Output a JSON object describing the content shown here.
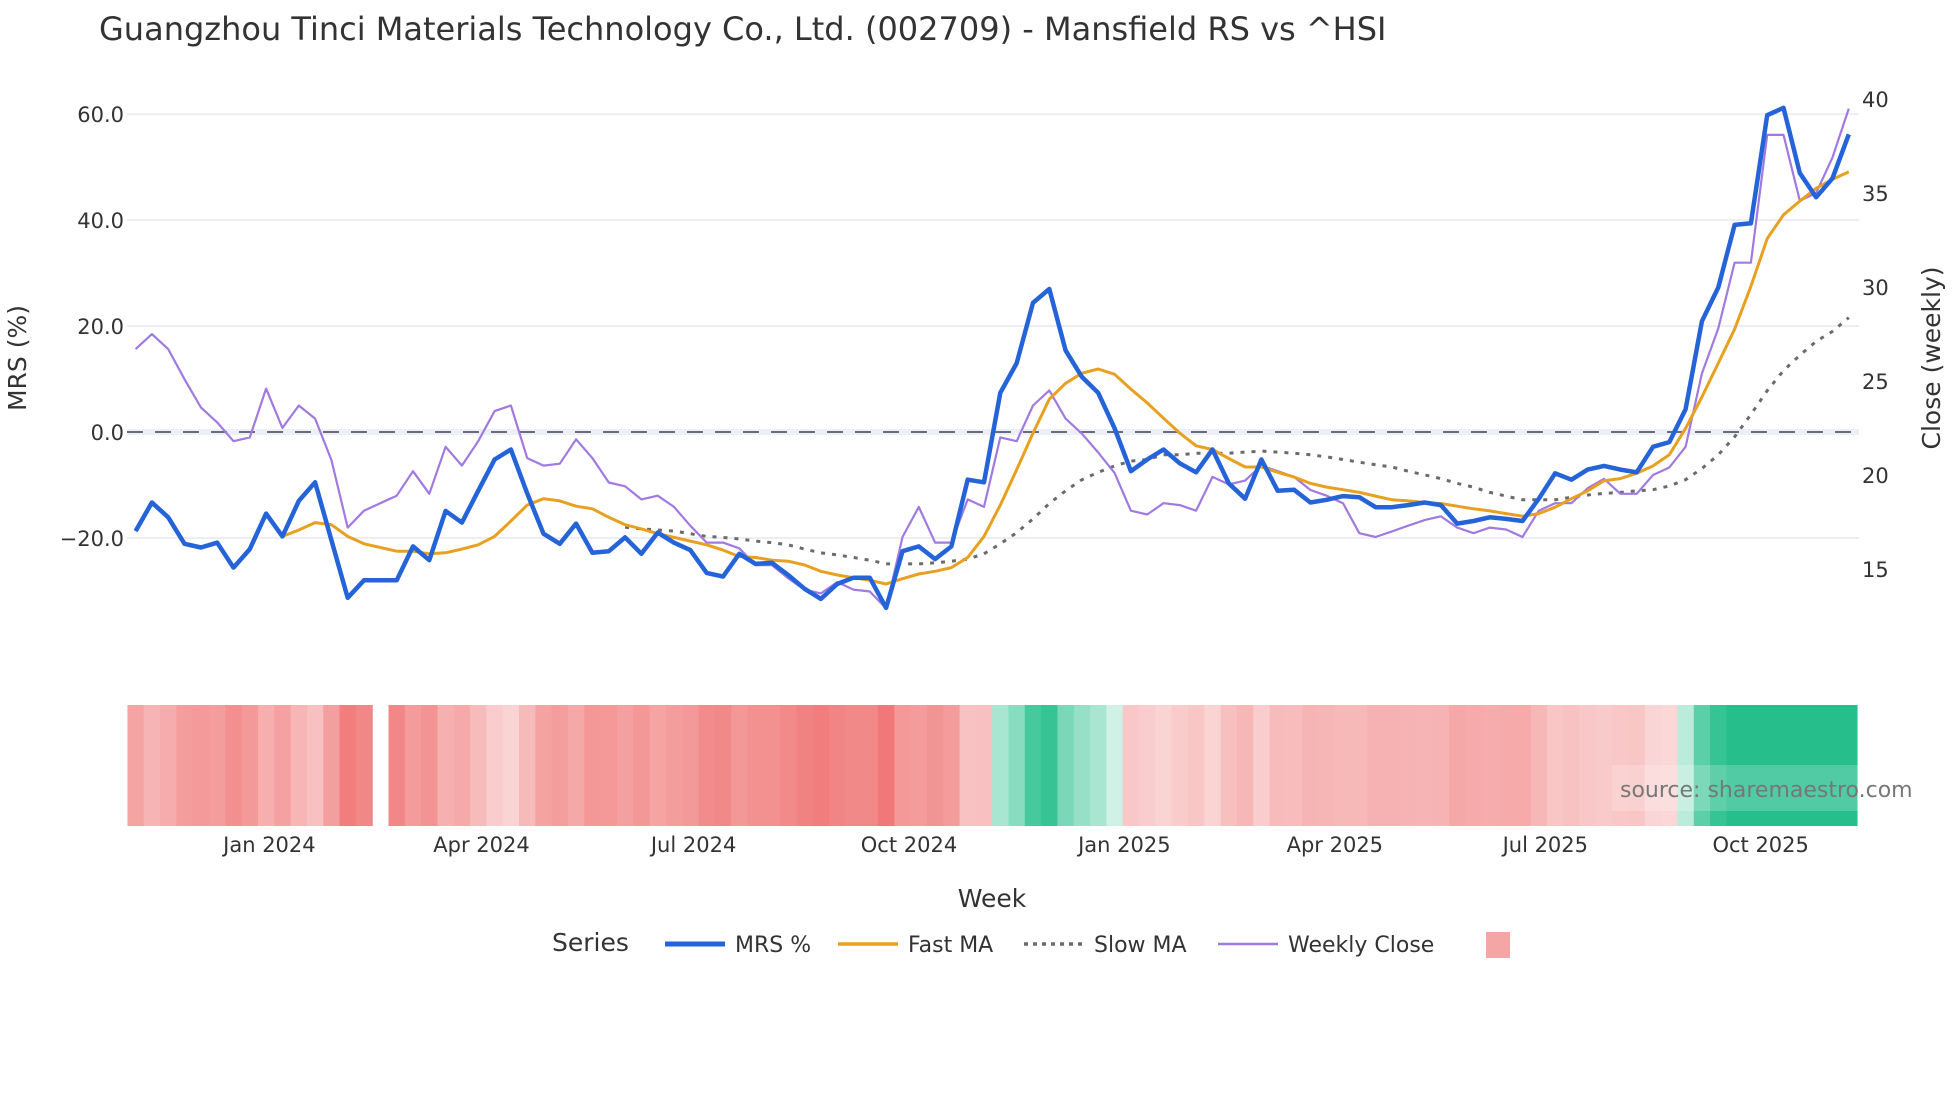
{
  "chart_data": {
    "type": "line",
    "title": "Guangzhou Tinci Materials Technology Co., Ltd. (002709) - Mansfield RS vs ^HSI",
    "xlabel": "Week",
    "ylabel": "MRS (%)",
    "y2label": "Close (weekly)",
    "ylim": [
      -38,
      64
    ],
    "y2lim": [
      11,
      40.5
    ],
    "yticks": [
      60,
      40,
      20,
      0,
      -20
    ],
    "ytick_labels": [
      "60.0",
      "40.0",
      "20.0",
      "0.0",
      "−20.0"
    ],
    "y2ticks": [
      40,
      35,
      30,
      25,
      20,
      15
    ],
    "y2tick_labels": [
      "40",
      "35",
      "30",
      "25",
      "20",
      "15"
    ],
    "zero_line": 0,
    "grid": true,
    "n_weeks": 106,
    "x_tick_labels": [
      {
        "label": "Jan 2024",
        "week": 8.2
      },
      {
        "label": "Apr 2024",
        "week": 21.2
      },
      {
        "label": "Jul 2024",
        "week": 34.2
      },
      {
        "label": "Oct 2024",
        "week": 47.4
      },
      {
        "label": "Jan 2025",
        "week": 60.6
      },
      {
        "label": "Apr 2025",
        "week": 73.5
      },
      {
        "label": "Jul 2025",
        "week": 86.4
      },
      {
        "label": "Oct 2025",
        "week": 99.6
      }
    ],
    "series": [
      {
        "name": "MRS %",
        "axis": "y",
        "color": "#2563d9",
        "start": 0,
        "values": [
          -18.7,
          -13.3,
          -16.1,
          -21.1,
          -21.8,
          -20.9,
          -25.6,
          -22.1,
          -15.4,
          -19.7,
          -13.0,
          -9.5,
          -20.4,
          -31.3,
          -28.0,
          -28.0,
          -28.0,
          -21.6,
          -24.2,
          -14.9,
          -17.1,
          -11.1,
          -5.2,
          -3.3,
          -11.6,
          -19.2,
          -21.1,
          -17.3,
          -22.8,
          -22.5,
          -19.9,
          -23.0,
          -19.0,
          -20.9,
          -22.3,
          -26.6,
          -27.3,
          -23.0,
          -24.9,
          -24.7,
          -27.0,
          -29.6,
          -31.5,
          -28.7,
          -27.5,
          -27.5,
          -33.2,
          -22.5,
          -21.6,
          -24.0,
          -21.6,
          -9.0,
          -9.5,
          7.4,
          13.0,
          24.4,
          27.0,
          15.4,
          10.4,
          7.4,
          0.7,
          -7.4,
          -5.2,
          -3.3,
          -5.9,
          -7.6,
          -3.3,
          -9.7,
          -12.6,
          -5.2,
          -11.1,
          -10.9,
          -13.3,
          -12.8,
          -12.1,
          -12.3,
          -14.2,
          -14.2,
          -13.8,
          -13.3,
          -13.8,
          -17.3,
          -16.8,
          -16.1,
          -16.4,
          -16.8,
          -12.6,
          -7.8,
          -9.0,
          -7.1,
          -6.4,
          -7.1,
          -7.6,
          -2.8,
          -1.9,
          4.3,
          20.9,
          27.3,
          39.1,
          39.4,
          59.8,
          61.2,
          48.9,
          44.3,
          47.9,
          56.2
        ]
      },
      {
        "name": "Fast MA",
        "axis": "y",
        "color": "#e8a020",
        "start": 9,
        "values": [
          -19.7,
          -18.5,
          -17.1,
          -17.5,
          -19.7,
          -21.1,
          -21.8,
          -22.5,
          -22.5,
          -23.0,
          -22.8,
          -22.1,
          -21.3,
          -19.7,
          -16.8,
          -13.8,
          -12.6,
          -13.0,
          -14.0,
          -14.5,
          -16.1,
          -17.5,
          -18.3,
          -19.2,
          -19.9,
          -20.6,
          -21.3,
          -22.3,
          -23.5,
          -23.7,
          -24.2,
          -24.4,
          -25.1,
          -26.3,
          -27.0,
          -27.5,
          -28.0,
          -28.7,
          -27.7,
          -26.8,
          -26.3,
          -25.6,
          -23.7,
          -19.7,
          -13.8,
          -7.1,
          -0.2,
          6.2,
          9.2,
          11.1,
          11.9,
          10.9,
          8.1,
          5.5,
          2.6,
          -0.2,
          -2.6,
          -3.3,
          -5.0,
          -6.6,
          -6.6,
          -7.6,
          -8.5,
          -9.7,
          -10.4,
          -10.9,
          -11.4,
          -12.1,
          -12.8,
          -13.0,
          -13.3,
          -13.5,
          -14.0,
          -14.5,
          -14.9,
          -15.4,
          -15.9,
          -15.4,
          -14.2,
          -12.6,
          -11.1,
          -9.2,
          -8.8,
          -7.8,
          -6.4,
          -4.3,
          0.7,
          6.6,
          13.0,
          19.4,
          27.5,
          36.5,
          41.0,
          43.6,
          46.0,
          47.7,
          49.1
        ]
      },
      {
        "name": "Slow MA",
        "axis": "y",
        "color": "#6b6b6b",
        "start": 30,
        "values": [
          -18.0,
          -18.3,
          -18.5,
          -18.7,
          -19.2,
          -19.7,
          -19.9,
          -20.2,
          -20.6,
          -20.9,
          -21.3,
          -22.1,
          -22.8,
          -23.2,
          -23.7,
          -24.2,
          -24.9,
          -24.9,
          -24.9,
          -24.7,
          -24.4,
          -24.0,
          -23.0,
          -21.1,
          -19.0,
          -16.4,
          -13.5,
          -11.1,
          -9.0,
          -7.6,
          -6.4,
          -5.5,
          -5.2,
          -4.3,
          -4.3,
          -4.0,
          -4.0,
          -4.0,
          -3.8,
          -3.6,
          -3.8,
          -4.0,
          -4.3,
          -4.7,
          -5.2,
          -5.7,
          -6.2,
          -6.6,
          -7.4,
          -8.1,
          -8.8,
          -9.7,
          -10.4,
          -11.4,
          -12.1,
          -12.8,
          -12.8,
          -12.8,
          -12.3,
          -11.9,
          -11.6,
          -11.4,
          -11.1,
          -10.9,
          -10.2,
          -9.0,
          -6.9,
          -4.3,
          -0.9,
          3.3,
          7.8,
          11.6,
          14.5,
          17.1,
          19.0,
          21.6
        ]
      },
      {
        "name": "Weekly Close",
        "axis": "y2",
        "color": "#a07ae0",
        "start": 0,
        "values": [
          26.7,
          27.5,
          26.7,
          25.1,
          23.6,
          22.8,
          21.8,
          22.0,
          24.6,
          22.5,
          23.7,
          23.0,
          20.8,
          17.2,
          18.1,
          18.5,
          18.9,
          20.2,
          19.0,
          21.5,
          20.5,
          21.8,
          23.4,
          23.7,
          20.9,
          20.5,
          20.6,
          21.9,
          20.9,
          19.6,
          19.4,
          18.7,
          18.9,
          18.3,
          17.3,
          16.4,
          16.4,
          16.1,
          15.2,
          15.2,
          14.5,
          13.9,
          13.7,
          14.3,
          13.9,
          13.8,
          12.9,
          16.7,
          18.3,
          16.4,
          16.4,
          18.7,
          18.3,
          22.0,
          21.8,
          23.7,
          24.5,
          23.0,
          22.2,
          21.2,
          20.1,
          18.1,
          17.9,
          18.5,
          18.4,
          18.1,
          19.9,
          19.5,
          19.7,
          20.5,
          20.2,
          19.9,
          19.2,
          18.9,
          18.5,
          16.9,
          16.7,
          17.0,
          17.3,
          17.6,
          17.8,
          17.2,
          16.9,
          17.2,
          17.1,
          16.7,
          18.1,
          18.5,
          18.5,
          19.3,
          19.8,
          19.0,
          19.0,
          20.0,
          20.4,
          21.5,
          25.4,
          27.8,
          31.3,
          31.3,
          38.1,
          38.1,
          34.6,
          35.0,
          36.9,
          39.5
        ]
      }
    ],
    "heatmap": {
      "missing_weeks": [
        15
      ],
      "neg_color": "#f07878",
      "pos_color": "#26bf8c"
    },
    "legend": {
      "title": "Series",
      "placement": "bottom",
      "items": [
        "MRS %",
        "Fast MA",
        "Slow MA",
        "Weekly Close"
      ],
      "extra_swatch_color": "#f4a6a6"
    }
  },
  "source": "source: sharemaestro.com"
}
